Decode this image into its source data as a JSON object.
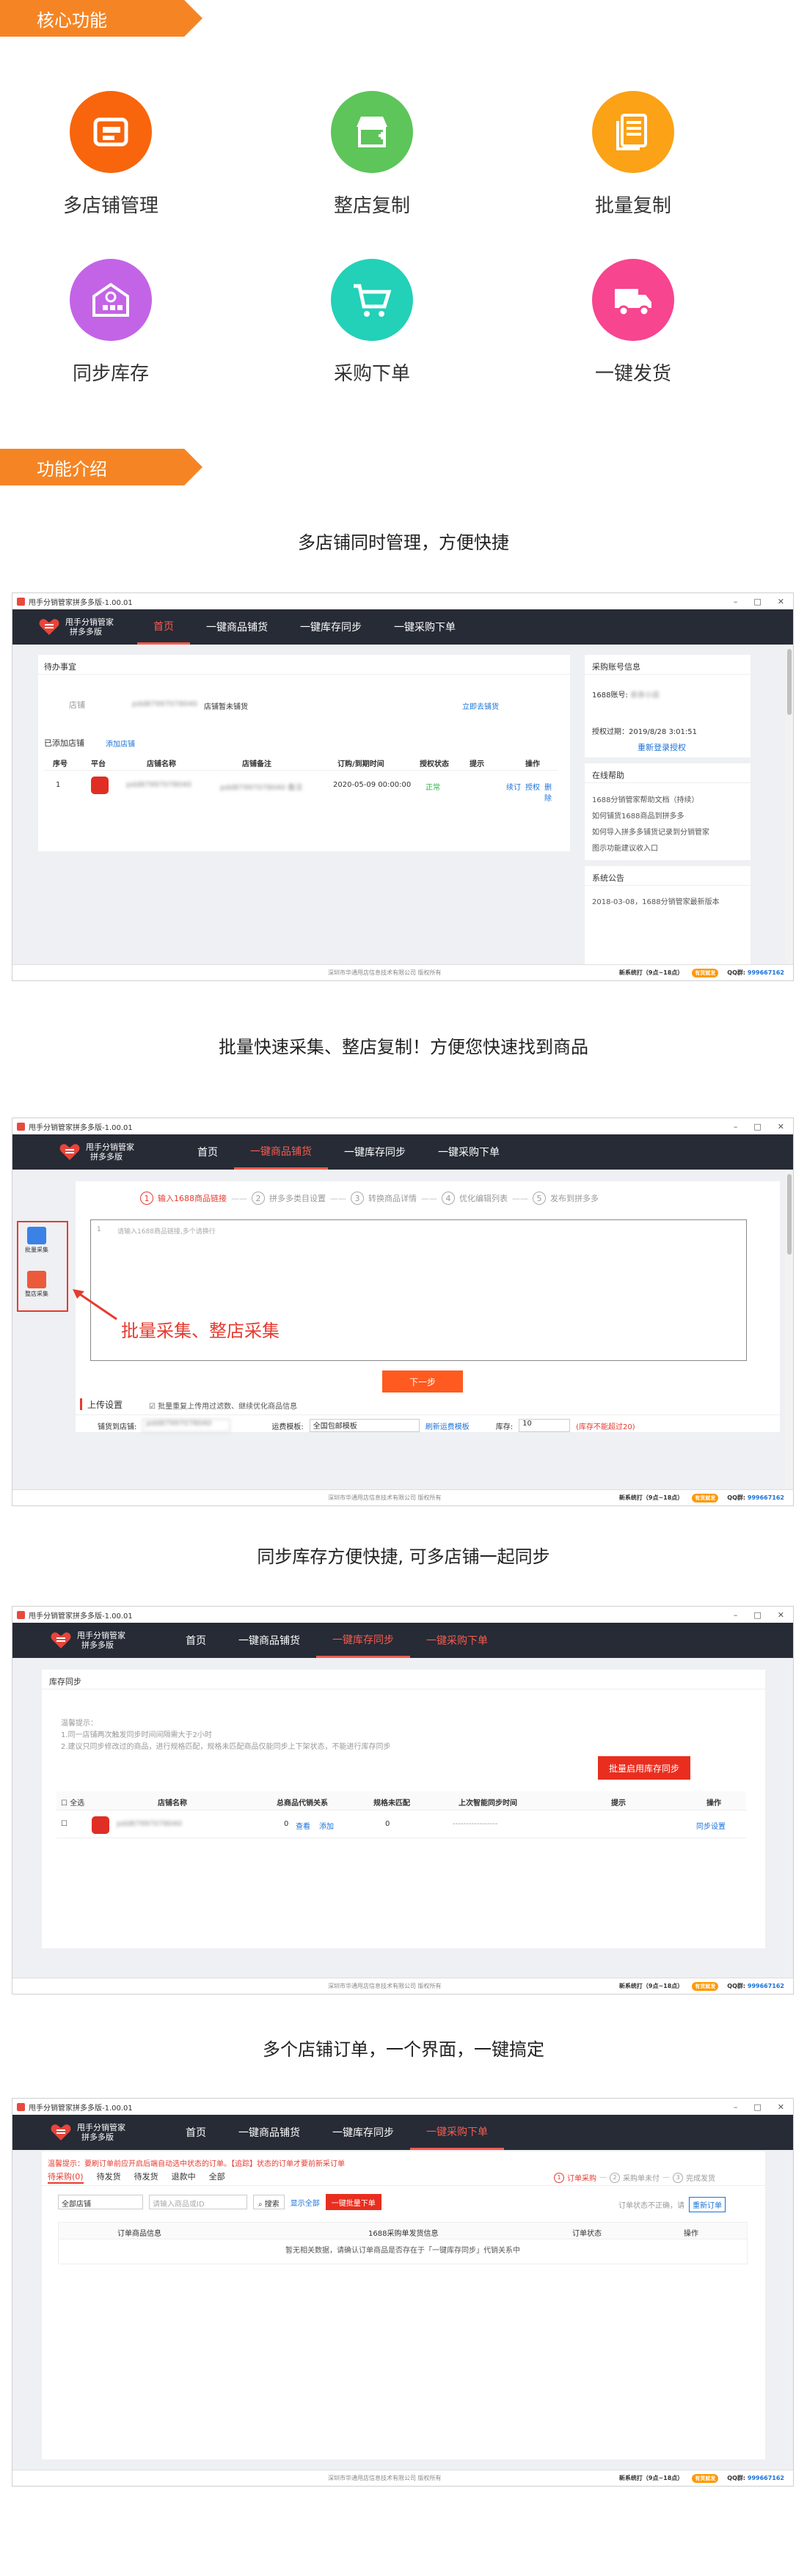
{
  "sections": {
    "core": "核心功能",
    "intro": "功能介绍"
  },
  "features": [
    {
      "label": "多店铺管理",
      "color": "#f8650c",
      "icon": "store-manage-icon"
    },
    {
      "label": "整店复制",
      "color": "#5dc55a",
      "icon": "shop-copy-icon"
    },
    {
      "label": "批量复制",
      "color": "#fba217",
      "icon": "batch-copy-icon"
    },
    {
      "label": "同步库存",
      "color": "#c364e6",
      "icon": "warehouse-sync-icon"
    },
    {
      "label": "采购下单",
      "color": "#22d1b8",
      "icon": "cart-order-icon"
    },
    {
      "label": "一键发货",
      "color": "#f7458f",
      "icon": "truck-icon"
    }
  ],
  "captions": [
    "多店铺同时管理，方便快捷",
    "批量快速采集、整店复制！方便您快速找到商品",
    "同步库存方便快捷, 可多店铺一起同步",
    "多个店铺订单，一个界面，一键搞定"
  ],
  "app": {
    "title": "甩手分销管家拼多多版-1.00.01",
    "brand_line1": "甩手分销管家",
    "brand_line2": "拼多多版",
    "nav": [
      "首页",
      "一键商品铺货",
      "一键库存同步",
      "一键采购下单"
    ],
    "footer": "深圳市华通甩店信息技术有限公司   版权所有",
    "footer_link": "新系统打（9点~18点）",
    "footer_badge": "有货就发",
    "footer_qq_label": "QQ群",
    "footer_qq": "999667162"
  },
  "win1": {
    "todo_title": "待办事宜",
    "store_label": "店铺",
    "store_id": "pdd87997078040",
    "store_status": "店铺暂未铺货",
    "go_link": "立即去铺货",
    "added_title": "已添加店铺",
    "add_link": "添加店铺",
    "headers": [
      "序号",
      "平台",
      "店铺名称",
      "店铺备注",
      "订购/到期时间",
      "授权状态",
      "提示",
      "操作"
    ],
    "row": {
      "no": "1",
      "name": "pdd87997078040",
      "remark": "pdd87997078040 备注",
      "time": "2020-05-09 00:00:00",
      "status": "正常",
      "ops": [
        "续订",
        "授权",
        "删除"
      ]
    },
    "account_title": "采购账号信息",
    "account_label": "1688账号:",
    "account_value": "亲亲小店",
    "expire": "授权过期：2019/8/28 3:01:51",
    "reauth": "重新登录授权",
    "help_title": "在线帮助",
    "help_items": [
      "1688分销管家帮助文档（持续）",
      "如何铺货1688商品到拼多多",
      "如何导入拼多多铺货记录到分销管家",
      "图示功能建议收入口"
    ],
    "notice_title": "系统公告",
    "notice_item": "2018-03-08，1688分销管家最新版本"
  },
  "win2": {
    "steps": [
      "输入1688商品链接",
      "拼多多类目设置",
      "转换商品详情",
      "优化编辑列表",
      "发布到拼多多"
    ],
    "placeholder": "请输入1688商品链接,多个请换行",
    "line_no": "1",
    "side_items": [
      "批量采集",
      "整店采集"
    ],
    "annotation": "批量采集、整店采集",
    "next_button": "下一步",
    "upload_title": "上传设置",
    "upload_check": "批量重复上传用过滤数、继续优化商品信息",
    "store_label": "铺货到店铺:",
    "store_value": "pdd87997078040",
    "template_label": "运费模板:",
    "template_value": "全国包邮模板",
    "refresh_link": "刷新运费模板",
    "stock_label": "库存:",
    "stock_value": "10",
    "stock_hint": "(库存不能超过20)"
  },
  "win3": {
    "title": "库存同步",
    "tips": [
      "温馨提示：",
      "1.同一店铺两次触发同步时间间隔需大于2小时",
      "2.建议只同步修改过的商品，进行规格匹配，规格未匹配商品仅能同步上下架状态，不能进行库存同步"
    ],
    "sync_button": "批量启用库存同步",
    "headers": [
      "全选",
      "店铺名称",
      "总商品代销关系",
      "规格未匹配",
      "上次智能同步时间",
      "提示",
      "操作"
    ],
    "row": {
      "name": "pdd87997078040",
      "total": "0",
      "view": "查看",
      "add": "添加",
      "unmatched": "0",
      "time": "-----------------",
      "op": "同步设置"
    }
  },
  "win4": {
    "warning": "温馨提示：要刷订单前应开启后端自动选中状态的订单。【追踪】状态的订单才要前新采订单",
    "tabs": [
      "待采购(0)",
      "待发货",
      "待发货",
      "退款中",
      "全部"
    ],
    "steps": [
      "订单采购",
      "采购单未付",
      "完成发货"
    ],
    "store_select": "全部店铺",
    "search_placeholder": "请输入商品或ID",
    "search_button": "搜索",
    "show_all": "显示全部",
    "batch_button": "一键批量下单",
    "status_hint": "订单状态不正确，请",
    "refresh_order": "重新订单",
    "headers": [
      "订单商品信息",
      "1688采购单发货信息",
      "订单状态",
      "操作"
    ],
    "empty": "暂无相关数据，请确认订单商品是否存在于「一键库存同步」代销关系中"
  }
}
